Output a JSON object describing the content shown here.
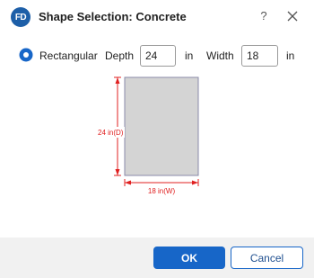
{
  "window": {
    "logo_text": "FD",
    "title": "Shape Selection: Concrete",
    "help_label": "?"
  },
  "shape": {
    "option_label": "Rectangular",
    "selected": true,
    "depth_label": "Depth",
    "depth_value": "24",
    "depth_unit": "in",
    "width_label": "Width",
    "width_value": "18",
    "width_unit": "in"
  },
  "preview": {
    "depth_dim_label": "24 in(D)",
    "width_dim_label": "18 in(W)",
    "fill_color": "#d4d4d4",
    "outline_color": "#8a8aa8",
    "dimension_color": "#e02020"
  },
  "footer": {
    "ok_label": "OK",
    "cancel_label": "Cancel"
  }
}
